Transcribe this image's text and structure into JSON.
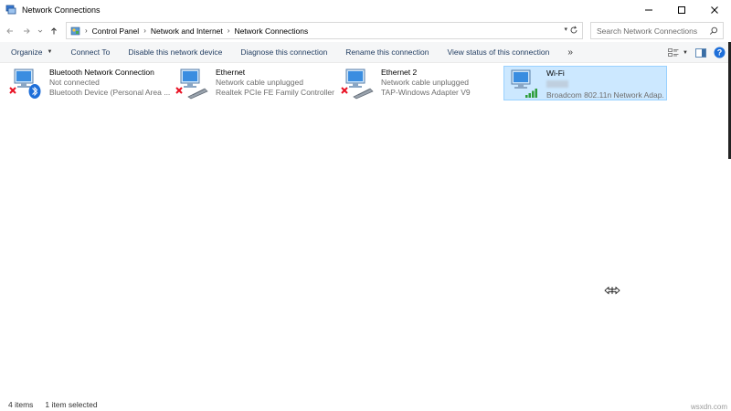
{
  "window": {
    "title": "Network Connections",
    "controls": [
      "minimize-icon",
      "maximize-icon",
      "close-icon"
    ]
  },
  "address": {
    "crumbs": [
      "Control Panel",
      "Network and Internet",
      "Network Connections"
    ],
    "search_placeholder": "Search Network Connections"
  },
  "commands": {
    "organize": "Organize",
    "connect_to": "Connect To",
    "disable": "Disable this network device",
    "diagnose": "Diagnose this connection",
    "rename": "Rename this connection",
    "view_status": "View status of this connection",
    "more": "»"
  },
  "connections": [
    {
      "name": "Bluetooth Network Connection",
      "status": "Not connected",
      "device": "Bluetooth Device (Personal Area ...",
      "icon": "bluetooth-adapter-icon",
      "selected": false
    },
    {
      "name": "Ethernet",
      "status": "Network cable unplugged",
      "device": "Realtek PCIe FE Family Controller",
      "icon": "ethernet-adapter-icon",
      "selected": false
    },
    {
      "name": "Ethernet 2",
      "status": "Network cable unplugged",
      "device": "TAP-Windows Adapter V9",
      "icon": "ethernet-adapter-icon",
      "selected": false
    },
    {
      "name": "Wi-Fi",
      "status": "",
      "device": "Broadcom 802.11n Network Adap...",
      "icon": "wifi-adapter-icon",
      "selected": true
    }
  ],
  "statusbar": {
    "item_count": "4 items",
    "selected_count": "1 item selected"
  },
  "watermark": "wsxdn.com",
  "colors": {
    "selection_bg": "#cce8ff",
    "selection_border": "#99d1ff",
    "toolbar_bg": "#f5f6f7",
    "error_red": "#e81123",
    "help_blue": "#1e6fd9"
  }
}
